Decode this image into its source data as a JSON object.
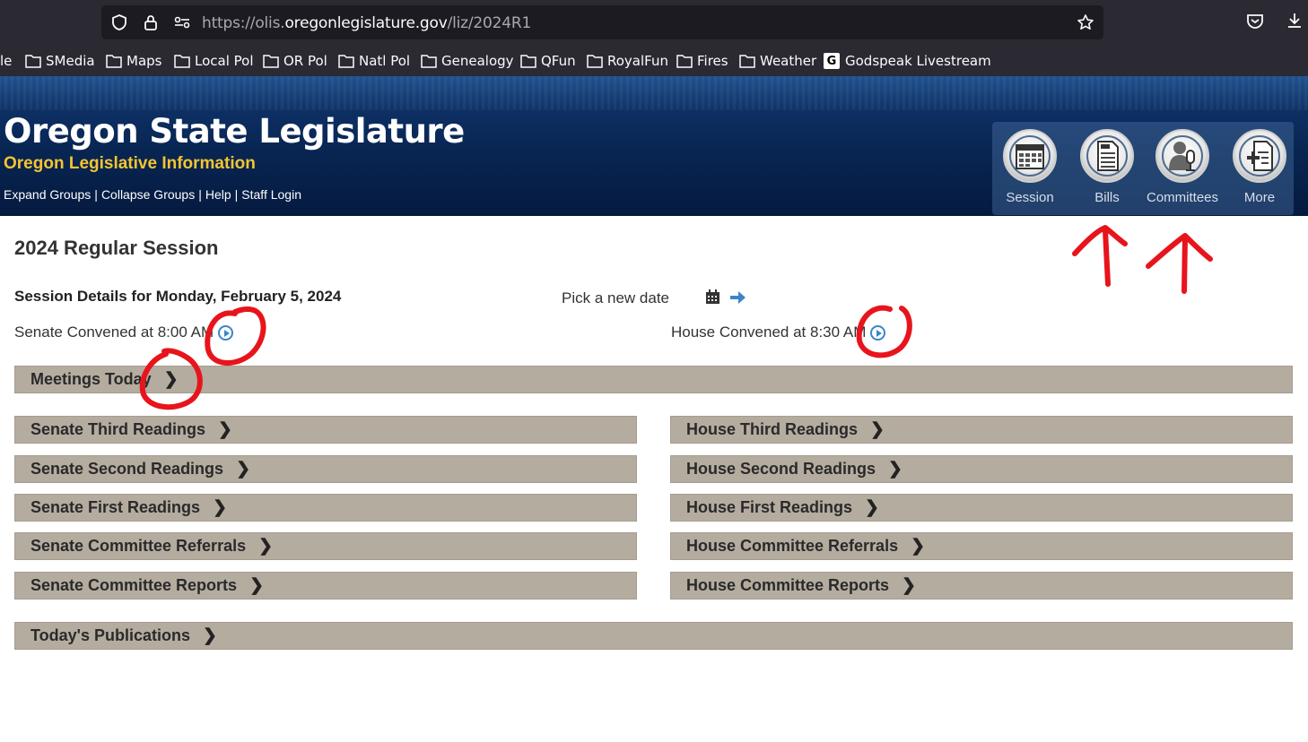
{
  "browser": {
    "url_prefix": "https://olis.",
    "url_domain": "oregonlegislature.gov",
    "url_path": "/liz/2024R1",
    "bookmarks": [
      {
        "label": "le",
        "icon": "none"
      },
      {
        "label": "SMedia",
        "icon": "folder-icon"
      },
      {
        "label": "Maps",
        "icon": "folder-icon"
      },
      {
        "label": "Local Pol",
        "icon": "folder-icon"
      },
      {
        "label": "OR Pol",
        "icon": "folder-icon"
      },
      {
        "label": "Natl Pol",
        "icon": "folder-icon"
      },
      {
        "label": "Genealogy",
        "icon": "folder-icon"
      },
      {
        "label": "QFun",
        "icon": "folder-icon"
      },
      {
        "label": "RoyalFun",
        "icon": "folder-icon"
      },
      {
        "label": "Fires",
        "icon": "folder-icon"
      },
      {
        "label": "Weather",
        "icon": "folder-icon"
      },
      {
        "label": "Godspeak Livestream",
        "icon": "g-favicon",
        "favicon_letter": "G"
      }
    ]
  },
  "header": {
    "title": "Oregon State Legislature",
    "subtitle": "Oregon Legislative Information",
    "links": [
      "Expand Groups",
      "Collapse Groups",
      "Help",
      "Staff Login"
    ],
    "separator": "|",
    "nav": [
      {
        "label": "Session",
        "icon": "calendar-icon"
      },
      {
        "label": "Bills",
        "icon": "bill-document-icon"
      },
      {
        "label": "Committees",
        "icon": "microphone-person-icon"
      },
      {
        "label": "More",
        "icon": "plus-document-icon"
      }
    ]
  },
  "main": {
    "session_title": "2024 Regular Session",
    "details": "Session Details for Monday, February 5, 2024",
    "pick_date": "Pick a new date",
    "senate_convened": "Senate Convened at 8:00 AM",
    "house_convened": "House Convened at 8:30 AM",
    "meetings": "Meetings Today",
    "senate_groups": [
      "Senate Third Readings",
      "Senate Second Readings",
      "Senate First Readings",
      "Senate Committee Referrals",
      "Senate Committee Reports"
    ],
    "house_groups": [
      "House Third Readings",
      "House Second Readings",
      "House First Readings",
      "House Committee Referrals",
      "House Committee Reports"
    ],
    "publications": "Today's Publications"
  },
  "colors": {
    "bar": "#b5aca0",
    "subtitle": "#f3c531",
    "annotation": "#e8141c",
    "play": "#3a86c8"
  }
}
